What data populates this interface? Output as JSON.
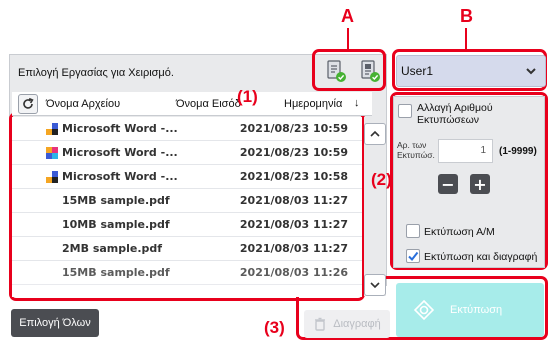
{
  "annotations": {
    "a": "A",
    "b": "B",
    "n1": "(1)",
    "n2": "(2)",
    "n3": "(3)"
  },
  "header": {
    "title": "Επιλογή Εργασίας για Χειρισμό."
  },
  "user_select": {
    "value": "User1"
  },
  "columns": {
    "file_name": "Όνομα Αρχείου",
    "user_name": "Όνομα Εισόδ",
    "date": "Ημερομηνία",
    "sort_glyph": "↓"
  },
  "files": [
    {
      "name": "Microsoft Word -...",
      "date": "2021/08/23 10:59",
      "icon": "word-color-icon"
    },
    {
      "name": "Microsoft Word -...",
      "date": "2021/08/23 10:59",
      "icon": "word-color-icon"
    },
    {
      "name": "Microsoft Word -...",
      "date": "2021/08/23 10:58",
      "icon": "word-color-icon"
    },
    {
      "name": "15MB sample.pdf",
      "date": "2021/08/03 11:27",
      "icon": ""
    },
    {
      "name": "10MB sample.pdf",
      "date": "2021/08/03 11:27",
      "icon": ""
    },
    {
      "name": "2MB sample.pdf",
      "date": "2021/08/03 11:27",
      "icon": ""
    },
    {
      "name": "15MB sample.pdf",
      "date": "2021/08/03 11:26",
      "icon": ""
    }
  ],
  "side": {
    "change_copies_label": "Αλλαγή Αριθμού Εκτυπώσεων",
    "copies_label": "Αρ. των Εκτυπώσ.",
    "copies_value": "1",
    "copies_range": "(1-9999)",
    "minus": "−",
    "plus": "+",
    "print_bw_label": "Εκτύπωση Α/Μ",
    "print_bw_checked": false,
    "print_delete_label": "Εκτύπωση και διαγραφή",
    "print_delete_checked": true
  },
  "buttons": {
    "select_all": "Επιλογή Όλων",
    "delete": "Διαγραφή",
    "print": "Εκτύπωση"
  },
  "colors": {
    "annotation": "#e8001c",
    "print_button": "#a7ecea",
    "accent_blue": "#2a6fdb",
    "green_badge": "#46b233"
  }
}
